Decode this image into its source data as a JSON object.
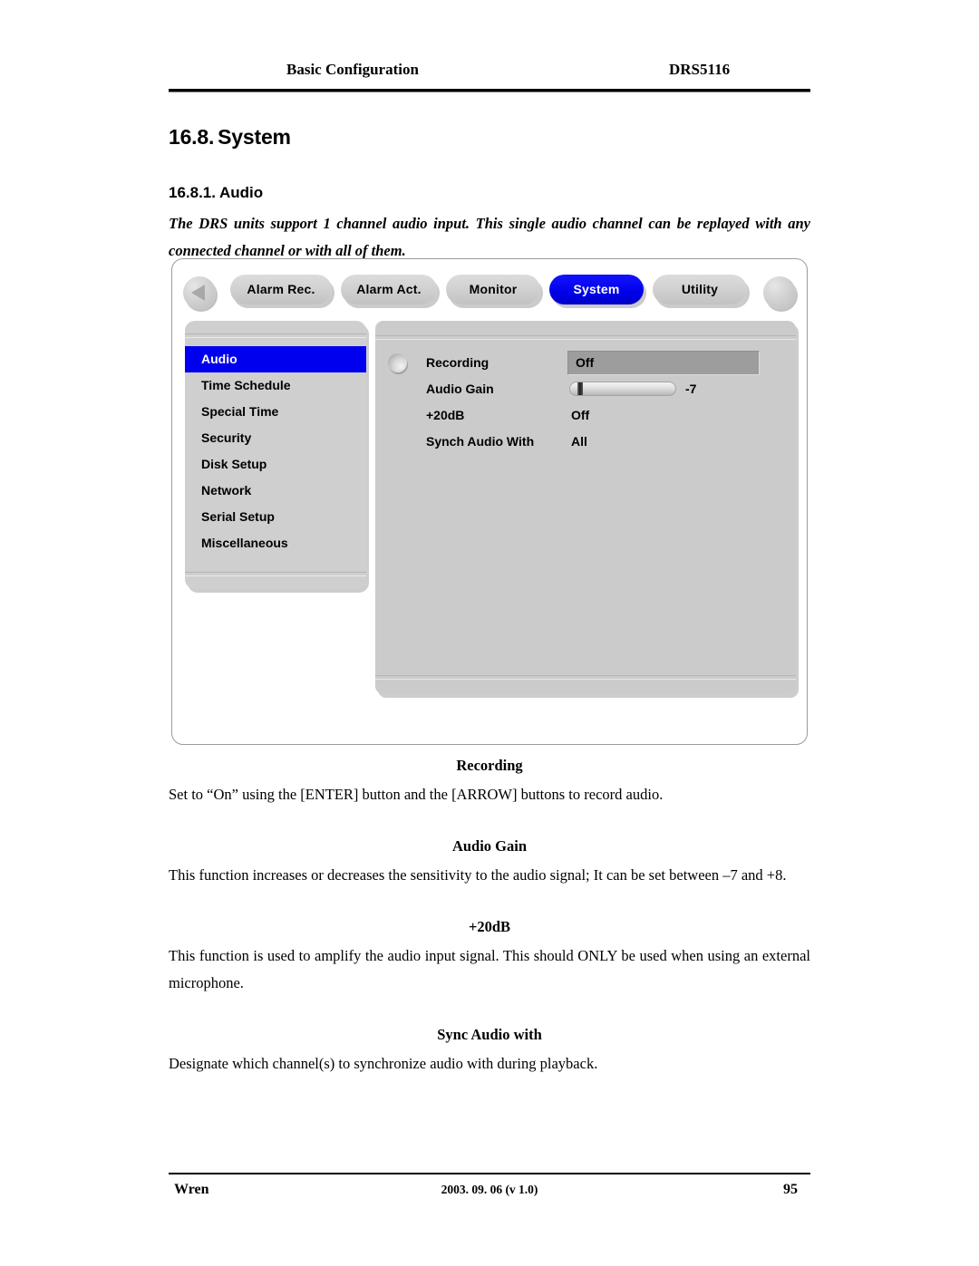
{
  "header": {
    "left_title": "Basic Configuration",
    "right_title": "DRS5116"
  },
  "section": {
    "number": "16.8.",
    "title": "System"
  },
  "subsection": {
    "number": "16.8.1.",
    "title": "Audio",
    "intro": "The DRS units support 1 channel audio input.   This single audio channel can be replayed with any connected channel or with all of them."
  },
  "device_ui": {
    "tabs": [
      {
        "label": "Alarm Rec.",
        "active": false
      },
      {
        "label": "Alarm Act.",
        "active": false
      },
      {
        "label": "Monitor",
        "active": false
      },
      {
        "label": "System",
        "active": true
      },
      {
        "label": "Utility",
        "active": false
      }
    ],
    "nav": {
      "prev_icon": "triangle-left-icon",
      "next_icon": "circle-button-icon"
    },
    "menu": {
      "items": [
        {
          "label": "Audio",
          "selected": true
        },
        {
          "label": "Time Schedule",
          "selected": false
        },
        {
          "label": "Special Time",
          "selected": false
        },
        {
          "label": "Security",
          "selected": false
        },
        {
          "label": "Disk Setup",
          "selected": false
        },
        {
          "label": "Network",
          "selected": false
        },
        {
          "label": "Serial Setup",
          "selected": false
        },
        {
          "label": "Miscellaneous",
          "selected": false
        }
      ]
    },
    "settings": {
      "recording": {
        "label": "Recording",
        "value": "Off"
      },
      "audio_gain": {
        "label": "Audio Gain",
        "value": "-7",
        "slider_position_pct": 7
      },
      "plus20db": {
        "label": "+20dB",
        "value": "Off"
      },
      "synch_audio_with": {
        "label": "Synch Audio With",
        "value": "All"
      }
    },
    "colors": {
      "accent_blue": "#0000ee",
      "panel_gray": "#cbcbcb",
      "menu_gray": "#cfcfcf",
      "highlight_gray": "#9d9d9d"
    }
  },
  "body_sections": [
    {
      "heading": "Recording",
      "text": "Set to “On” using the [ENTER] button and the [ARROW] buttons to record audio."
    },
    {
      "heading": "Audio Gain",
      "text": "This function increases or decreases the sensitivity to the audio signal; It can be set between –7 and +8."
    },
    {
      "heading": "+20dB",
      "text": "This function is used to amplify the audio input signal.   This should ONLY be used when using an external microphone."
    },
    {
      "heading": "Sync Audio with",
      "text": "Designate which channel(s) to synchronize audio with during playback."
    }
  ],
  "footer": {
    "left": "Wren",
    "center": "2003. 09. 06 (v 1.0)",
    "page_number": "95"
  }
}
